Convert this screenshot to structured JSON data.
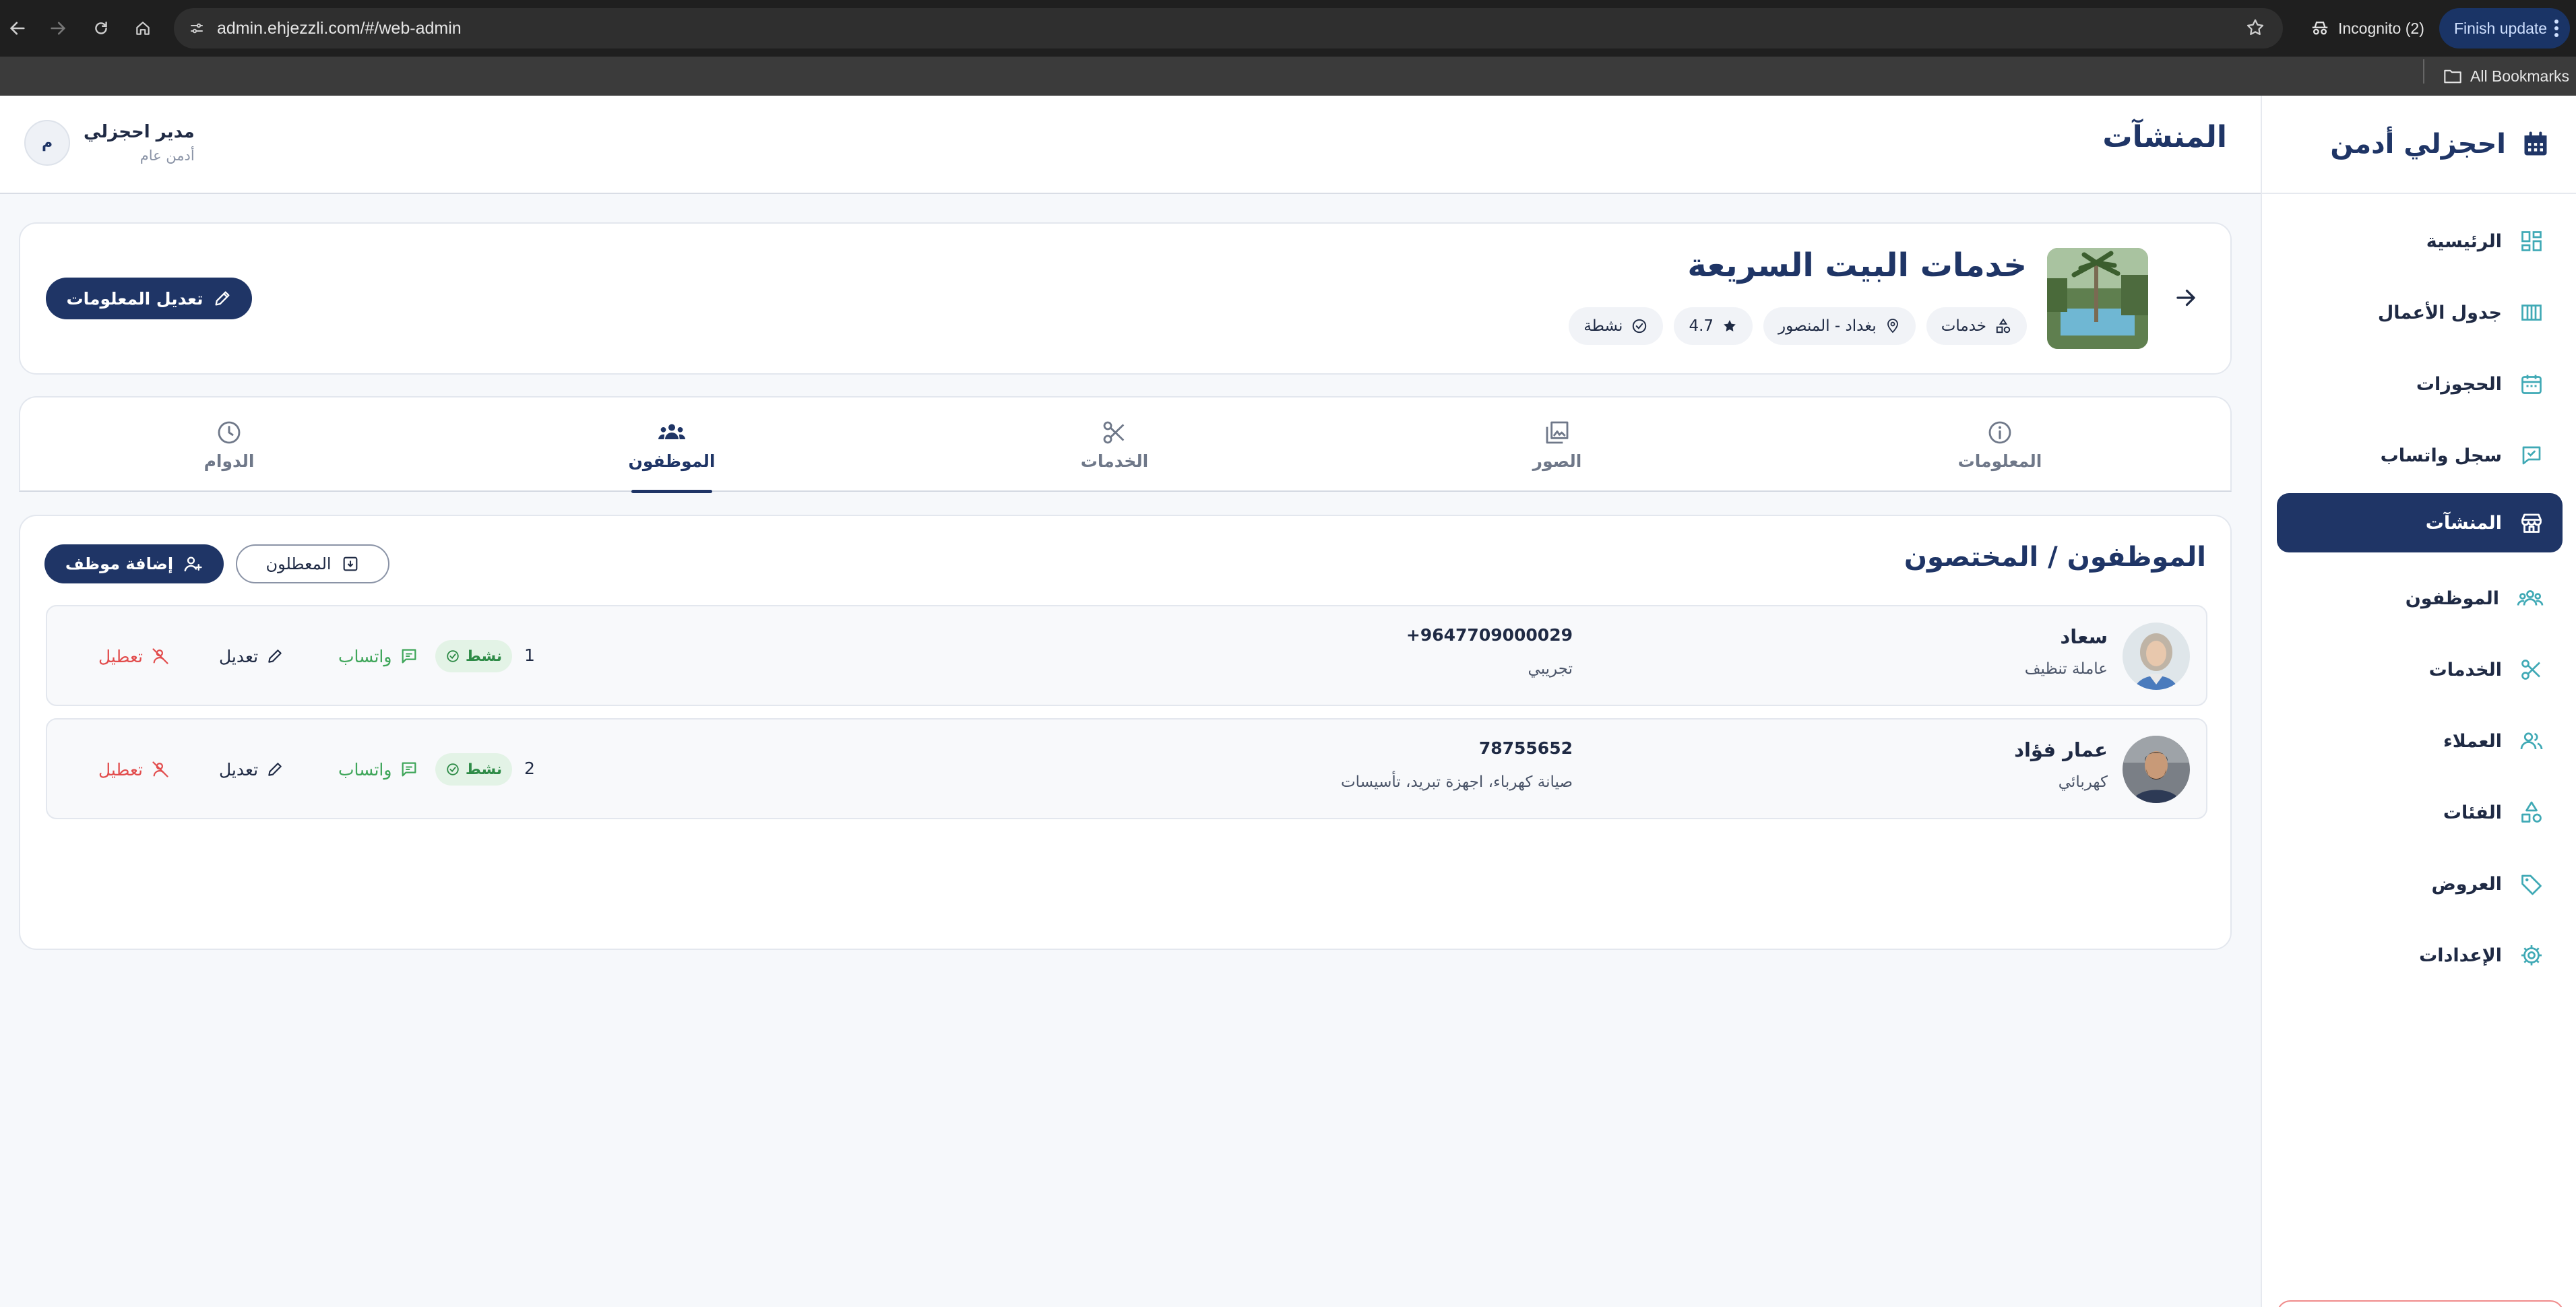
{
  "browser": {
    "url": "admin.ehjezzli.com/#/web-admin",
    "incognito_label": "Incognito (2)",
    "update_label": "Finish update",
    "bookmarks_label": "All Bookmarks"
  },
  "sidebar": {
    "brand": "احجزلي أدمن",
    "items": [
      {
        "label": "الرئيسية",
        "icon": "dashboard-icon"
      },
      {
        "label": "جدول الأعمال",
        "icon": "schedule-icon"
      },
      {
        "label": "الحجوزات",
        "icon": "calendar-icon"
      },
      {
        "label": "سجل واتساب",
        "icon": "chat-icon"
      },
      {
        "label": "المنشآت",
        "icon": "store-icon",
        "active": true
      },
      {
        "label": "الموظفون",
        "icon": "group-icon"
      },
      {
        "label": "الخدمات",
        "icon": "scissors-icon"
      },
      {
        "label": "العملاء",
        "icon": "people-icon"
      },
      {
        "label": "الفئات",
        "icon": "shapes-icon"
      },
      {
        "label": "العروض",
        "icon": "tag-icon"
      },
      {
        "label": "الإعدادات",
        "icon": "gear-icon"
      }
    ]
  },
  "header": {
    "page_title": "المنشآت",
    "user_name": "مدير احجزلي",
    "user_role": "أدمن عام",
    "avatar_initial": "م"
  },
  "facility": {
    "name": "خدمات البيت السريعة",
    "category": "خدمات",
    "location": "بغداد - المنصور",
    "rating": "4.7",
    "status": "نشطة",
    "edit_label": "تعديل المعلومات"
  },
  "tabs": [
    {
      "label": "المعلومات",
      "icon": "info-icon"
    },
    {
      "label": "الصور",
      "icon": "photos-icon"
    },
    {
      "label": "الخدمات",
      "icon": "scissors-icon"
    },
    {
      "label": "الموظفون",
      "icon": "group-icon",
      "active": true
    },
    {
      "label": "الدوام",
      "icon": "clock-icon"
    }
  ],
  "staff": {
    "title": "الموظفون / المختصون",
    "add_label": "إضافة موظف",
    "inactive_label": "المعطلون",
    "employees": [
      {
        "name": "سعاد",
        "role": "عاملة تنظيف",
        "phone": "+9647709000029",
        "notes": "تجريبي",
        "order": "1",
        "status": "نشط",
        "whatsapp": "واتساب",
        "edit": "تعديل",
        "disable": "تعطيل"
      },
      {
        "name": "عمار فؤاد",
        "role": "كهربائي",
        "phone": "78755652",
        "notes": "صيانة كهرباء، اجهزة تبريد، تأسيسات",
        "order": "2",
        "status": "نشط",
        "whatsapp": "واتساب",
        "edit": "تعديل",
        "disable": "تعطيل"
      }
    ]
  },
  "colors": {
    "primary": "#1f3566",
    "accent_teal": "#3fa9b5",
    "success": "#2e8b47",
    "danger": "#e24c4c",
    "whatsapp": "#3fa65a"
  }
}
